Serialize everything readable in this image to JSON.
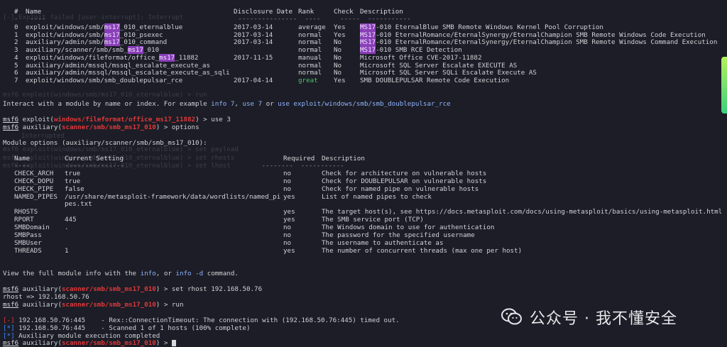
{
  "search_table": {
    "headers": {
      "num": "#",
      "name": "Name",
      "date": "Disclosure Date",
      "rank": "Rank",
      "check": "Check",
      "desc": "Description"
    },
    "rows": [
      {
        "num": "0",
        "name_a": "exploit/windows/smb/",
        "name_hl": "ms17",
        "name_b": "_010_eternalblue",
        "date": "2017-03-14",
        "rank": "average",
        "check": "Yes",
        "desc_hl": "MS17",
        "desc_rest": "-010 EternalBlue SMB Remote Windows Kernel Pool Corruption"
      },
      {
        "num": "1",
        "name_a": "exploit/windows/smb/",
        "name_hl": "ms17",
        "name_b": "_010_psexec",
        "date": "2017-03-14",
        "rank": "normal",
        "check": "Yes",
        "desc_hl": "MS17",
        "desc_rest": "-010 EternalRomance/EternalSynergy/EternalChampion SMB Remote Windows Code Execution"
      },
      {
        "num": "2",
        "name_a": "auxiliary/admin/smb/",
        "name_hl": "ms17",
        "name_b": "_010_command",
        "date": "2017-03-14",
        "rank": "normal",
        "check": "No",
        "desc_hl": "MS17",
        "desc_rest": "-010 EternalRomance/EternalSynergy/EternalChampion SMB Remote Windows Command Execution"
      },
      {
        "num": "3",
        "name_a": "auxiliary/scanner/smb/smb_",
        "name_hl": "ms17",
        "name_b": "_010",
        "date": "",
        "rank": "normal",
        "check": "No",
        "desc_hl": "MS17",
        "desc_rest": "-010 SMB RCE Detection"
      },
      {
        "num": "4",
        "name_a": "exploit/windows/fileformat/office_",
        "name_hl": "ms17",
        "name_b": "_11882",
        "date": "2017-11-15",
        "rank": "manual",
        "check": "No",
        "desc_hl": "",
        "desc_rest": "Microsoft Office CVE-2017-11882"
      },
      {
        "num": "5",
        "name_a": "auxiliary/admin/mssql/mssql_escalate_execute_as",
        "name_hl": "",
        "name_b": "",
        "date": "",
        "rank": "normal",
        "check": "No",
        "desc_hl": "",
        "desc_rest": "Microsoft SQL Server Escalate EXECUTE AS"
      },
      {
        "num": "6",
        "name_a": "auxiliary/admin/mssql/mssql_escalate_execute_as_sqli",
        "name_hl": "",
        "name_b": "",
        "date": "",
        "rank": "normal",
        "check": "No",
        "desc_hl": "",
        "desc_rest": "Microsoft SQL Server SQLi Escalate Execute AS"
      },
      {
        "num": "7",
        "name_a": "exploit/windows/smb/smb_doublepulsar_rce",
        "name_hl": "",
        "name_b": "",
        "date": "2017-04-14",
        "rank": "great",
        "check": "Yes",
        "desc_hl": "",
        "desc_rest": "SMB DOUBLEPULSAR Remote Code Execution"
      }
    ]
  },
  "interact_hint": {
    "a": "Interact with a module by name or index. For example ",
    "l1": "info 7",
    "b": ", ",
    "l2": "use 7",
    "c": " or ",
    "l3": "use exploit/windows/smb/smb_doublepulsar_rce"
  },
  "prompts": {
    "msf": "msf6",
    "p1_mod": "windows/fileformat/office_ms17_11882",
    "p1_pre": " exploit(",
    "p1_post": ") > use 3",
    "p2_pre": " auxiliary(",
    "p2_mod": "scanner/smb/smb_ms17_010",
    "p2_post": ") > options",
    "p3_post": ") > set rhost 192.168.50.76",
    "p4_post": ") > run",
    "p5_post": ") > "
  },
  "options": {
    "title": "Module options (auxiliary/scanner/smb/smb_ms17_010):",
    "headers": {
      "name": "Name",
      "setting": "Current Setting",
      "required": "Required",
      "desc": "Description"
    },
    "rows": [
      {
        "name": "CHECK_ARCH",
        "setting": "true",
        "required": "no",
        "desc": "Check for architecture on vulnerable hosts"
      },
      {
        "name": "CHECK_DOPU",
        "setting": "true",
        "required": "no",
        "desc": "Check for DOUBLEPULSAR on vulnerable hosts"
      },
      {
        "name": "CHECK_PIPE",
        "setting": "false",
        "required": "no",
        "desc": "Check for named pipe on vulnerable hosts"
      },
      {
        "name": "NAMED_PIPES",
        "setting": "/usr/share/metasploit-framework/data/wordlists/named_pi",
        "required": "yes",
        "desc": "List of named pipes to check"
      },
      {
        "name": "",
        "setting": "pes.txt",
        "required": "",
        "desc": ""
      },
      {
        "name": "RHOSTS",
        "setting": "",
        "required": "yes",
        "desc": "The target host(s), see https://docs.metasploit.com/docs/using-metasploit/basics/using-metasploit.html"
      },
      {
        "name": "RPORT",
        "setting": "445",
        "required": "yes",
        "desc": "The SMB service port (TCP)"
      },
      {
        "name": "SMBDomain",
        "setting": ".",
        "required": "no",
        "desc": "The Windows domain to use for authentication"
      },
      {
        "name": "SMBPass",
        "setting": "",
        "required": "no",
        "desc": "The password for the specified username"
      },
      {
        "name": "SMBUser",
        "setting": "",
        "required": "no",
        "desc": "The username to authenticate as"
      },
      {
        "name": "THREADS",
        "setting": "1",
        "required": "yes",
        "desc": "The number of concurrent threads (max one per host)"
      }
    ],
    "view_a": "View the full module info with the ",
    "view_l1": "info",
    "view_b": ", or ",
    "view_l2": "info -d",
    "view_c": " command."
  },
  "rhost_echo": "rhost => 192.168.50.76",
  "output": {
    "err_tag": "[-]",
    "err_text": " 192.168.50.76:445    - Rex::ConnectionTimeout: The connection with (192.168.50.76:445) timed out.",
    "scan_tag": "[*]",
    "scan_text": " 192.168.50.76:445    - Scanned 1 of 1 hosts (100% complete)",
    "done_tag": "[*]",
    "done_text": " Auxiliary module execution completed"
  },
  "ghost_lines": [
    "[-] Exploit failed [user-interrupt]: Interrupt",
    "msf6 exploit(windows/smb/ms17_010_eternalblue) > run",
    "msf6 exploit(windows/smb/ms17_010_eternalblue) > set payload",
    "msf6 exploit(windows/smb/ms17_010_eternalblue) > set rhosts",
    "msf6 exploit(windows/smb/ms17_010_eternalblue) > set lhost",
    "Interrupted"
  ],
  "watermark": "公众号 · 我不懂安全",
  "colors": {
    "bg": "#1c1d26",
    "highlight": "#8a3fb8",
    "module": "#e0383a",
    "link": "#8fb4ff",
    "ok": "#4fc46b",
    "info": "#3d88ff"
  }
}
